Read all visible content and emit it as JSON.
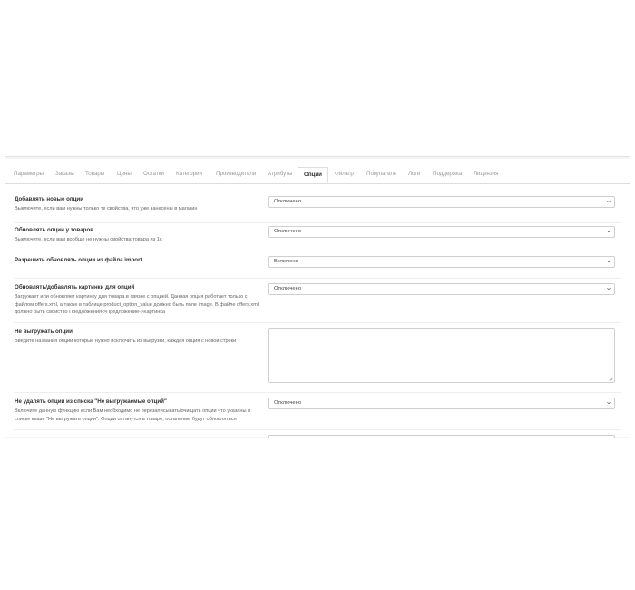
{
  "tabs": [
    {
      "label": "Параметры"
    },
    {
      "label": "Заказы"
    },
    {
      "label": "Товары"
    },
    {
      "label": "Цены"
    },
    {
      "label": "Остатки"
    },
    {
      "label": "Категории"
    },
    {
      "label": "Производители"
    },
    {
      "label": "Атрибуты"
    },
    {
      "label": "Опции"
    },
    {
      "label": "Фильтр"
    },
    {
      "label": "Покупатели"
    },
    {
      "label": "Логи"
    },
    {
      "label": "Поддержка"
    },
    {
      "label": "Лицензия"
    }
  ],
  "active_tab": "Опции",
  "settings": [
    {
      "title": "Добавлять новые опции",
      "description": "Выключите, если вам нужны только те свойства, что уже занесены в магазин",
      "value": "Отключено"
    },
    {
      "title": "Обновлять опции у товаров",
      "description": "Выключите, если вам вообще не нужны свойства товара из 1с",
      "value": "Отключено"
    },
    {
      "title": "Разрешить обновлять опции из файла import",
      "description": "",
      "value": "Включено"
    },
    {
      "title": "Обновлять/добавлять картинки для опций",
      "description": "Загружает или обновляет картинку для товара в связке с опцией. Данная опция работает только с файлом offers.xml, а также в таблице product_option_value должно быть поле image. В файле offers.xml должно быть свойство Предложения->Предложение->Картинка",
      "value": "Отключено"
    },
    {
      "title": "Не выгружать опции",
      "description": "Введите названия опций которые нужно исключить из выгрузки, каждая опция с новой строки",
      "value": ""
    },
    {
      "title": "Не удалять опции из списка \"Не выгружаемые опций\"",
      "description": "Включите данную функцию если Вам необходимо не перезаписывать/очищать опции что указаны в списке выше \"Не выгружать опции\". Опции останутся в товаре, остальные будут обновляться",
      "value": "Отключено"
    }
  ]
}
